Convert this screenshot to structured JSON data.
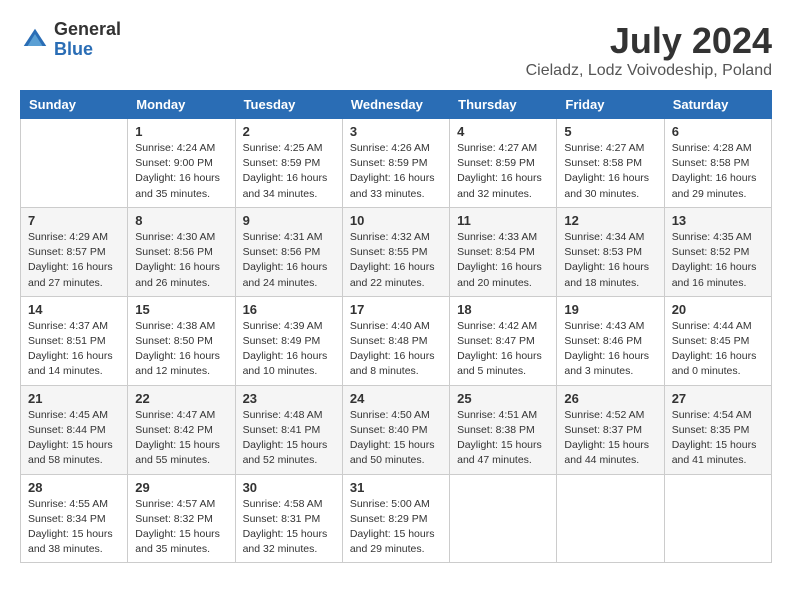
{
  "header": {
    "logo_line1": "General",
    "logo_line2": "Blue",
    "month": "July 2024",
    "location": "Cieladz, Lodz Voivodeship, Poland"
  },
  "weekdays": [
    "Sunday",
    "Monday",
    "Tuesday",
    "Wednesday",
    "Thursday",
    "Friday",
    "Saturday"
  ],
  "weeks": [
    [
      {
        "day": "",
        "info": ""
      },
      {
        "day": "1",
        "info": "Sunrise: 4:24 AM\nSunset: 9:00 PM\nDaylight: 16 hours\nand 35 minutes."
      },
      {
        "day": "2",
        "info": "Sunrise: 4:25 AM\nSunset: 8:59 PM\nDaylight: 16 hours\nand 34 minutes."
      },
      {
        "day": "3",
        "info": "Sunrise: 4:26 AM\nSunset: 8:59 PM\nDaylight: 16 hours\nand 33 minutes."
      },
      {
        "day": "4",
        "info": "Sunrise: 4:27 AM\nSunset: 8:59 PM\nDaylight: 16 hours\nand 32 minutes."
      },
      {
        "day": "5",
        "info": "Sunrise: 4:27 AM\nSunset: 8:58 PM\nDaylight: 16 hours\nand 30 minutes."
      },
      {
        "day": "6",
        "info": "Sunrise: 4:28 AM\nSunset: 8:58 PM\nDaylight: 16 hours\nand 29 minutes."
      }
    ],
    [
      {
        "day": "7",
        "info": "Sunrise: 4:29 AM\nSunset: 8:57 PM\nDaylight: 16 hours\nand 27 minutes."
      },
      {
        "day": "8",
        "info": "Sunrise: 4:30 AM\nSunset: 8:56 PM\nDaylight: 16 hours\nand 26 minutes."
      },
      {
        "day": "9",
        "info": "Sunrise: 4:31 AM\nSunset: 8:56 PM\nDaylight: 16 hours\nand 24 minutes."
      },
      {
        "day": "10",
        "info": "Sunrise: 4:32 AM\nSunset: 8:55 PM\nDaylight: 16 hours\nand 22 minutes."
      },
      {
        "day": "11",
        "info": "Sunrise: 4:33 AM\nSunset: 8:54 PM\nDaylight: 16 hours\nand 20 minutes."
      },
      {
        "day": "12",
        "info": "Sunrise: 4:34 AM\nSunset: 8:53 PM\nDaylight: 16 hours\nand 18 minutes."
      },
      {
        "day": "13",
        "info": "Sunrise: 4:35 AM\nSunset: 8:52 PM\nDaylight: 16 hours\nand 16 minutes."
      }
    ],
    [
      {
        "day": "14",
        "info": "Sunrise: 4:37 AM\nSunset: 8:51 PM\nDaylight: 16 hours\nand 14 minutes."
      },
      {
        "day": "15",
        "info": "Sunrise: 4:38 AM\nSunset: 8:50 PM\nDaylight: 16 hours\nand 12 minutes."
      },
      {
        "day": "16",
        "info": "Sunrise: 4:39 AM\nSunset: 8:49 PM\nDaylight: 16 hours\nand 10 minutes."
      },
      {
        "day": "17",
        "info": "Sunrise: 4:40 AM\nSunset: 8:48 PM\nDaylight: 16 hours\nand 8 minutes."
      },
      {
        "day": "18",
        "info": "Sunrise: 4:42 AM\nSunset: 8:47 PM\nDaylight: 16 hours\nand 5 minutes."
      },
      {
        "day": "19",
        "info": "Sunrise: 4:43 AM\nSunset: 8:46 PM\nDaylight: 16 hours\nand 3 minutes."
      },
      {
        "day": "20",
        "info": "Sunrise: 4:44 AM\nSunset: 8:45 PM\nDaylight: 16 hours\nand 0 minutes."
      }
    ],
    [
      {
        "day": "21",
        "info": "Sunrise: 4:45 AM\nSunset: 8:44 PM\nDaylight: 15 hours\nand 58 minutes."
      },
      {
        "day": "22",
        "info": "Sunrise: 4:47 AM\nSunset: 8:42 PM\nDaylight: 15 hours\nand 55 minutes."
      },
      {
        "day": "23",
        "info": "Sunrise: 4:48 AM\nSunset: 8:41 PM\nDaylight: 15 hours\nand 52 minutes."
      },
      {
        "day": "24",
        "info": "Sunrise: 4:50 AM\nSunset: 8:40 PM\nDaylight: 15 hours\nand 50 minutes."
      },
      {
        "day": "25",
        "info": "Sunrise: 4:51 AM\nSunset: 8:38 PM\nDaylight: 15 hours\nand 47 minutes."
      },
      {
        "day": "26",
        "info": "Sunrise: 4:52 AM\nSunset: 8:37 PM\nDaylight: 15 hours\nand 44 minutes."
      },
      {
        "day": "27",
        "info": "Sunrise: 4:54 AM\nSunset: 8:35 PM\nDaylight: 15 hours\nand 41 minutes."
      }
    ],
    [
      {
        "day": "28",
        "info": "Sunrise: 4:55 AM\nSunset: 8:34 PM\nDaylight: 15 hours\nand 38 minutes."
      },
      {
        "day": "29",
        "info": "Sunrise: 4:57 AM\nSunset: 8:32 PM\nDaylight: 15 hours\nand 35 minutes."
      },
      {
        "day": "30",
        "info": "Sunrise: 4:58 AM\nSunset: 8:31 PM\nDaylight: 15 hours\nand 32 minutes."
      },
      {
        "day": "31",
        "info": "Sunrise: 5:00 AM\nSunset: 8:29 PM\nDaylight: 15 hours\nand 29 minutes."
      },
      {
        "day": "",
        "info": ""
      },
      {
        "day": "",
        "info": ""
      },
      {
        "day": "",
        "info": ""
      }
    ]
  ]
}
